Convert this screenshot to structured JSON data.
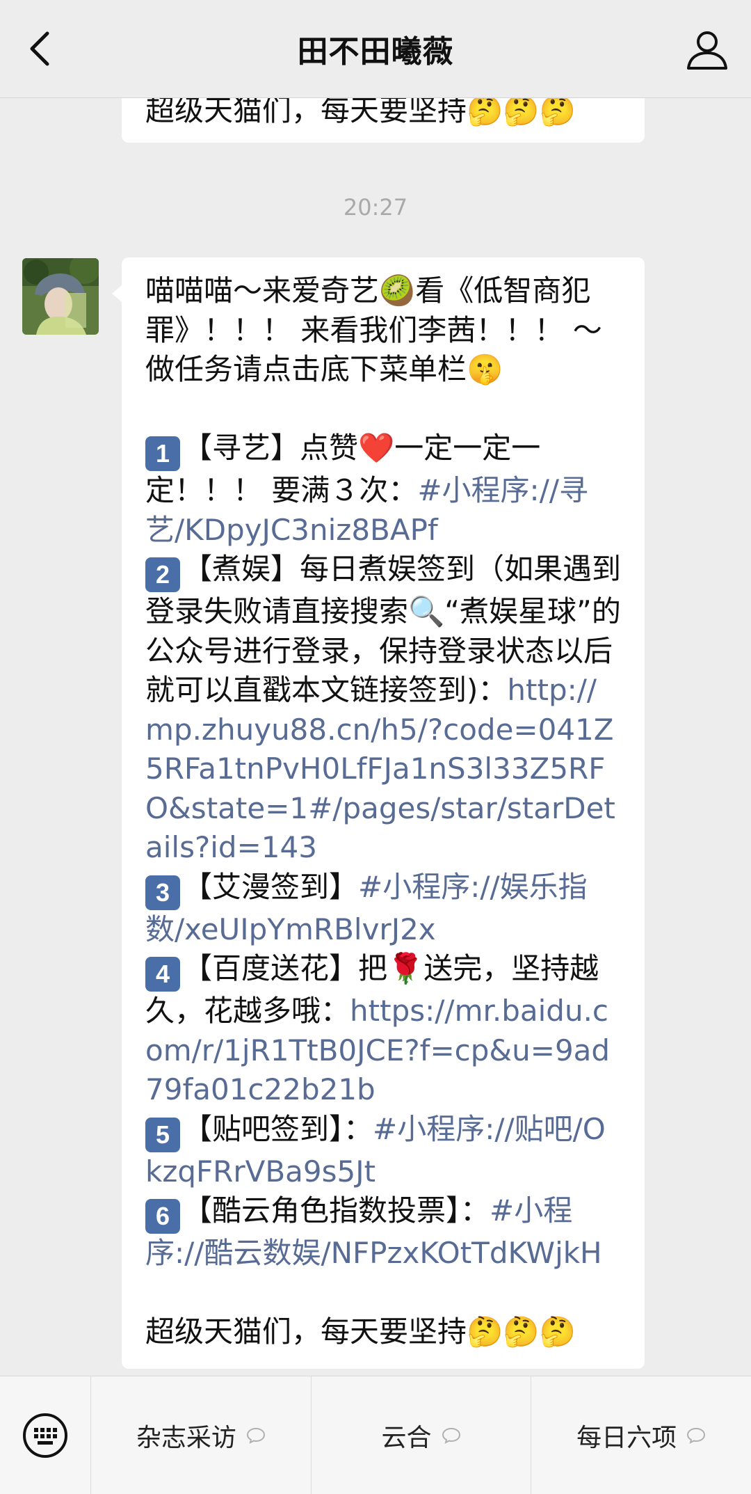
{
  "header": {
    "title": "田不田曦薇",
    "back_icon": "chevron-left-icon",
    "profile_icon": "person-icon"
  },
  "chat": {
    "previous_message_tail": "超级天猫们，每天要坚持🤔🤔🤔",
    "timestamp": "20:27",
    "message": {
      "intro": "喵喵喵～来爱奇艺🥝看《低智商犯罪》！！！ 来看我们李茜！！！ ～做任务请点击底下菜单栏🤫",
      "items": [
        {
          "num": "1",
          "text": "【寻艺】点赞❤️一定一定一定！！！ 要满３次：",
          "link": "#小程序://寻艺/KDpyJC3niz8BAPf"
        },
        {
          "num": "2",
          "text": "【煮娱】每日煮娱签到（如果遇到登录失败请直接搜索🔍“煮娱星球”的公众号进行登录，保持登录状态以后就可以直戳本文链接签到)：",
          "link": "http://mp.zhuyu88.cn/h5/?code=041Z5RFa1tnPvH0LfFJa1nS3l33Z5RFO&state=1#/pages/star/starDetails?id=143"
        },
        {
          "num": "3",
          "text": "【艾漫签到】",
          "link": "#小程序://娱乐指数/xeUIpYmRBlvrJ2x"
        },
        {
          "num": "4",
          "text": "【百度送花】把🌹送完，坚持越久，花越多哦：",
          "link": "https://mr.baidu.com/r/1jR1TtB0JCE?f=cp&u=9ad79fa01c22b21b"
        },
        {
          "num": "5",
          "text": "【贴吧签到】：",
          "link": "#小程序://贴吧/OkzqFRrVBa9s5Jt"
        },
        {
          "num": "6",
          "text": "【酷云角色指数投票】：",
          "link": "#小程序://酷云数娱/NFPzxKOtTdKWjkH"
        }
      ],
      "outro": "超级天猫们，每天要坚持🤔🤔🤔"
    }
  },
  "menu": {
    "keyboard_icon": "keyboard-icon",
    "items": [
      {
        "label": "杂志采访",
        "icon": "chat-bubble-icon"
      },
      {
        "label": "云合",
        "icon": "chat-bubble-icon"
      },
      {
        "label": "每日六项",
        "icon": "chat-bubble-icon"
      }
    ]
  },
  "colors": {
    "background": "#ededed",
    "bubble": "#ffffff",
    "link": "#576b95",
    "timestamp": "#a9a9a9"
  }
}
